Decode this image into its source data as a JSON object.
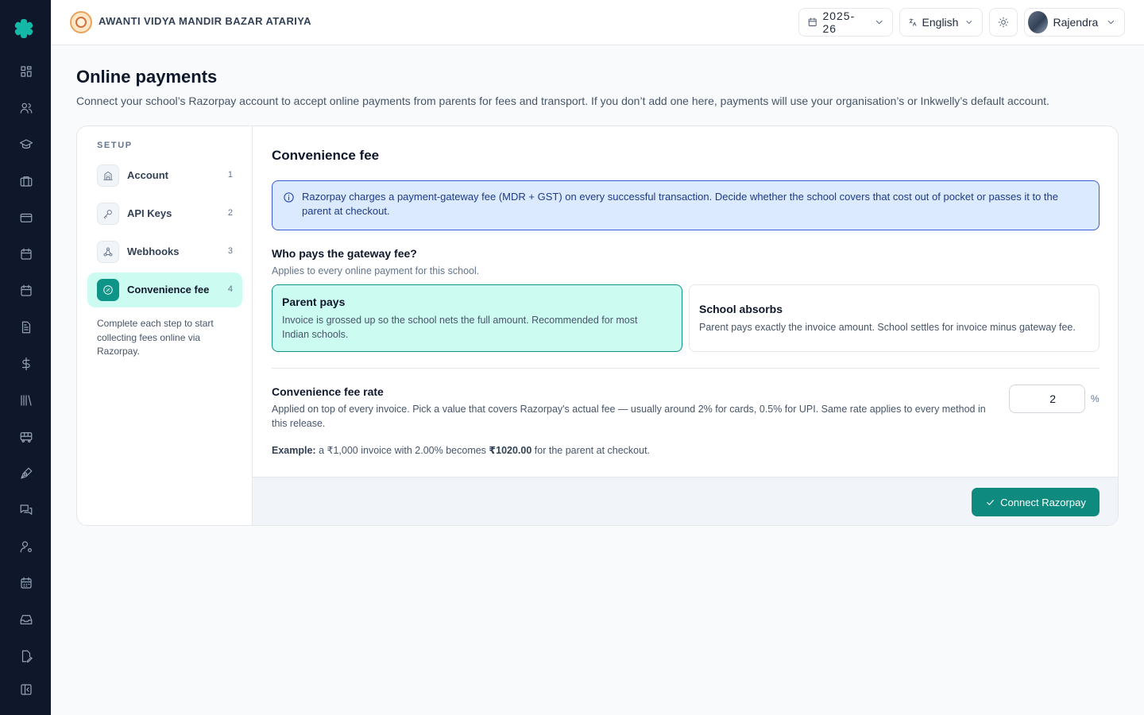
{
  "colors": {
    "accent": "#0f9488",
    "rail": "#0f172a",
    "info_bg": "#dbeafe",
    "selected_bg": "#ccfbf1"
  },
  "rail": {
    "logo_icon": "asterisk-logo-icon",
    "icons": [
      "dashboard-icon",
      "users-icon",
      "graduation-cap-icon",
      "briefcase-icon",
      "card-icon",
      "calendar-icon",
      "calendar-icon",
      "document-icon",
      "dollar-icon",
      "library-icon",
      "bus-icon",
      "pen-tool-icon",
      "messages-icon",
      "user-gear-icon",
      "calendar-grid-icon",
      "inbox-icon",
      "file-edit-icon",
      "sidebar-collapse-icon"
    ]
  },
  "header": {
    "school_name": "AWANTI VIDYA MANDIR BAZAR ATARIYA",
    "year": "2025-26",
    "language": "English",
    "user_name": "Rajendra"
  },
  "page": {
    "title": "Online payments",
    "subtitle": "Connect your school’s Razorpay account to accept online payments from parents for fees and transport. If you don’t add one here, payments will use your organisation’s or Inkwelly’s default account."
  },
  "setup": {
    "label": "SETUP",
    "steps": [
      {
        "label": "Account",
        "num": "1",
        "icon": "building-icon"
      },
      {
        "label": "API Keys",
        "num": "2",
        "icon": "key-icon"
      },
      {
        "label": "Webhooks",
        "num": "3",
        "icon": "webhook-icon"
      },
      {
        "label": "Convenience fee",
        "num": "4",
        "icon": "percent-icon",
        "active": true
      }
    ],
    "note": "Complete each step to start collecting fees online via Razorpay."
  },
  "convenience": {
    "title": "Convenience fee",
    "info": "Razorpay charges a payment-gateway fee (MDR + GST) on every successful transaction. Decide whether the school covers that cost out of pocket or passes it to the parent at checkout.",
    "question": "Who pays the gateway fee?",
    "question_sub": "Applies to every online payment for this school.",
    "options": [
      {
        "title": "Parent pays",
        "desc": "Invoice is grossed up so the school nets the full amount. Recommended for most Indian schools.",
        "selected": true
      },
      {
        "title": "School absorbs",
        "desc": "Parent pays exactly the invoice amount. School settles for invoice minus gateway fee.",
        "selected": false
      }
    ],
    "rate_title": "Convenience fee rate",
    "rate_desc": "Applied on top of every invoice. Pick a value that covers Razorpay's actual fee — usually around 2% for cards, 0.5% for UPI. Same rate applies to every method in this release.",
    "rate_value": "2",
    "rate_unit": "%",
    "example_label": "Example:",
    "example_pre": "a ₹1,000 invoice with 2.00% becomes",
    "example_amount": "₹1020.00",
    "example_post": "for the parent at checkout.",
    "connect_label": "Connect Razorpay"
  }
}
